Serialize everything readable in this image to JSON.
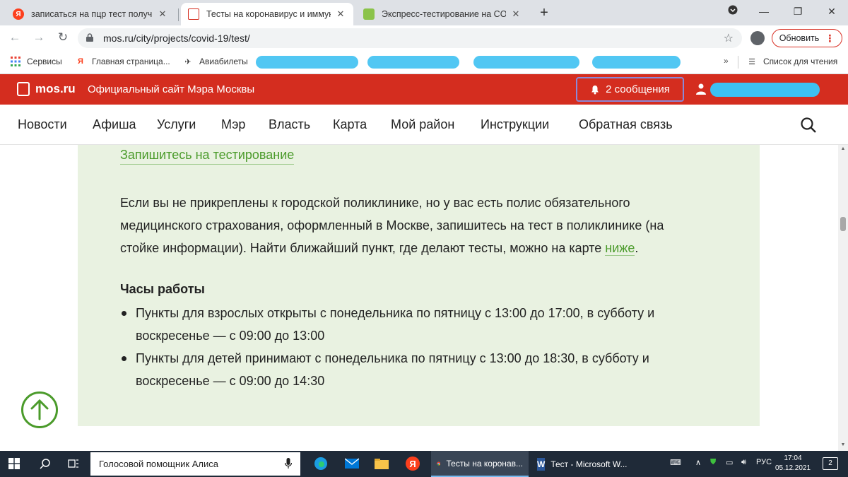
{
  "browser": {
    "tabs": [
      {
        "title": "записаться на пцр тест получит",
        "favicon": "Я",
        "favicon_color": "#fc3f1d",
        "active": false
      },
      {
        "title": "Тесты на коронавирус и иммун",
        "favicon": "",
        "favicon_color": "#d42d1f",
        "active": true
      },
      {
        "title": "Экспресс-тестирование на COV",
        "favicon": "",
        "favicon_color": "#8bc34a",
        "active": false
      }
    ],
    "url": "mos.ru/city/projects/covid-19/test/",
    "update_label": "Обновить",
    "bookmarks": [
      {
        "label": "Сервисы",
        "icon": "apps-grid-icon"
      },
      {
        "label": "Главная страница...",
        "icon": "yandex-icon"
      },
      {
        "label": "Авиабилеты",
        "icon": "plane-icon"
      }
    ],
    "reading_list": "Список для чтения"
  },
  "site": {
    "logo": "mos.ru",
    "tagline": "Официальный сайт Мэра Москвы",
    "messages": "2 сообщения",
    "accent_color": "#d42d1f"
  },
  "nav": {
    "items": [
      "Новости",
      "Афиша",
      "Услуги",
      "Мэр",
      "Власть",
      "Карта",
      "Мой район",
      "Инструкции",
      "Обратная связь"
    ]
  },
  "content": {
    "cta_link": "Запишитесь на тестирование",
    "paragraph_text": "Если вы не прикреплены к городской поликлинике, но у вас есть полис обязательного медицинского страхования, оформленный в Москве, запишитесь на тест в поликлинике (на стойке информации). Найти ближайший пункт, где делают тесты, можно на карте ",
    "paragraph_link": "ниже",
    "paragraph_end": ".",
    "hours_title": "Часы работы",
    "hours": [
      "Пункты для взрослых открыты с понедельника по пятницу с 13:00 до 17:00, в субботу и воскресенье — с 09:00 до 13:00",
      "Пункты для детей принимают с понедельника по пятницу с 13:00 до 18:30, в субботу и воскресенье — с 09:00 до 14:30"
    ],
    "green_color": "#4b9b2b"
  },
  "taskbar": {
    "search_text": "Голосовой помощник Алиса",
    "apps": [
      {
        "label": "Тесты на коронав...",
        "icon": "chrome-icon",
        "active": true
      },
      {
        "label": "Тест - Microsoft W...",
        "icon": "word-icon",
        "active": false
      }
    ],
    "lang": "РУС",
    "time": "17:04",
    "date": "05.12.2021",
    "notifications": "2"
  }
}
